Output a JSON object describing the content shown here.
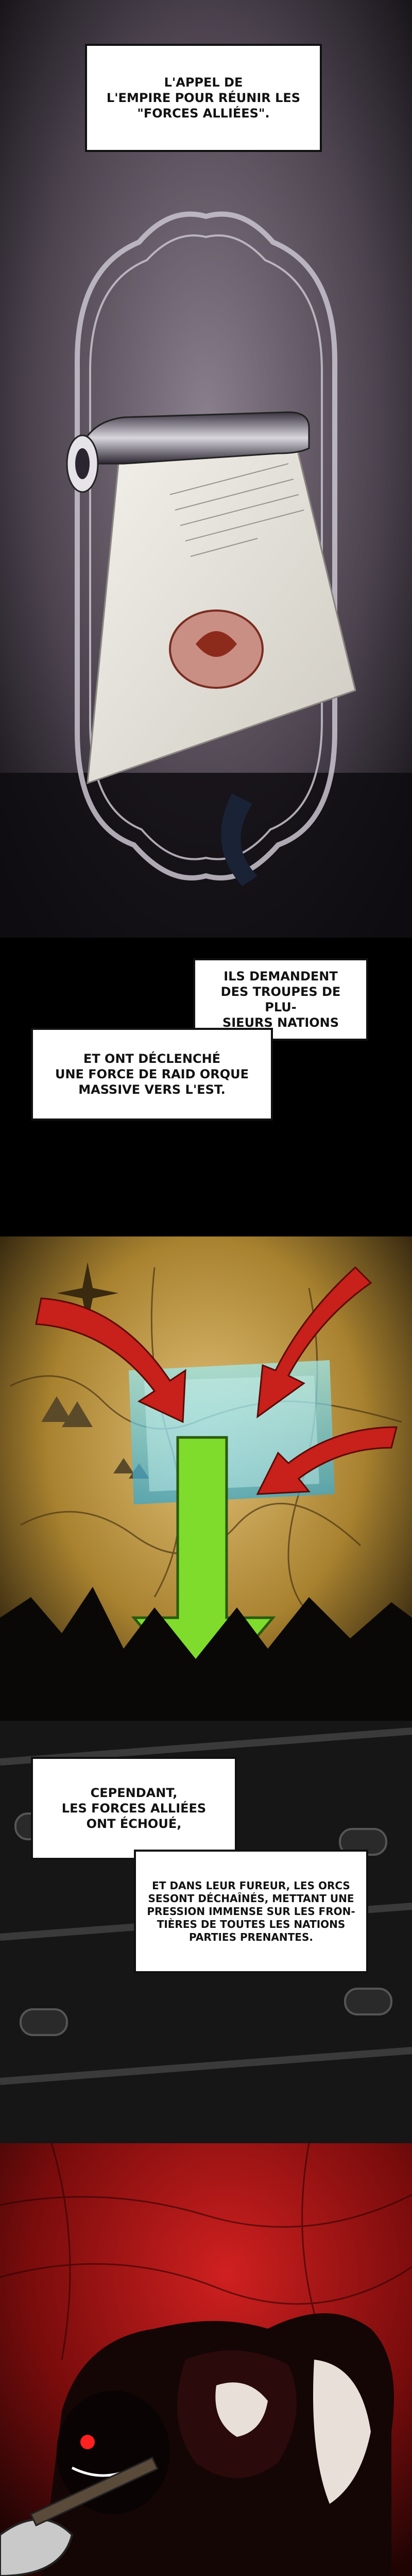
{
  "captions": {
    "c1": "L'APPEL DE\nL'EMPIRE POUR RÉUNIR LES\n\"FORCES ALLIÉES\".",
    "c2": "ILS DEMANDENT\nDES TROUPES DE PLU-\nSIEURS NATIONS",
    "c3": "ET ONT DÉCLENCHÉ\nUNE FORCE DE RAID ORQUE\nMASSIVE VERS L'EST.",
    "c4": "CEPENDANT,\nLES FORCES ALLIÉES\nONT ÉCHOUÉ,",
    "c5": "ET DANS LEUR FUREUR, LES ORCS\nSESONT DÉCHAÎNÉS, METTANT UNE\nPRESSION IMMENSE SUR LES FRON-\nTIÈRES DE TOUTES LES NATIONS\nPARTIES PRENANTES."
  },
  "colors": {
    "scroll_bg": "#6a5f6a",
    "map_bg": "#b8923f",
    "arrow_red": "#c8201a",
    "arrow_green": "#7fdc2c",
    "blood_red": "#a01010"
  }
}
